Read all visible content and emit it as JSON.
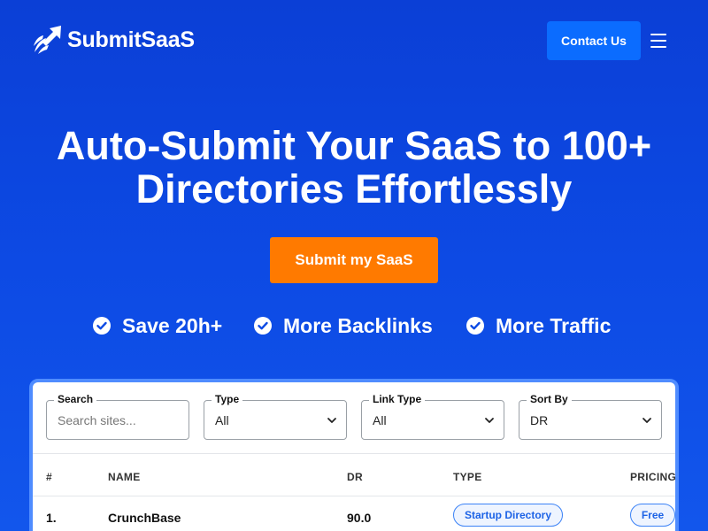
{
  "header": {
    "brand": "SubmitSaaS",
    "contact_label": "Contact Us",
    "logo_icon": "rocket-arrow-icon",
    "menu_icon": "hamburger-menu-icon"
  },
  "hero": {
    "title_line1": "Auto-Submit Your SaaS to 100+",
    "title_line2": "Directories Effortlessly",
    "cta_label": "Submit my SaaS",
    "benefits": [
      "Save 20h+",
      "More Backlinks",
      "More Traffic"
    ]
  },
  "filters": {
    "search": {
      "label": "Search",
      "placeholder": "Search sites..."
    },
    "type": {
      "label": "Type",
      "value": "All"
    },
    "link_type": {
      "label": "Link Type",
      "value": "All"
    },
    "sort_by": {
      "label": "Sort By",
      "value": "DR"
    }
  },
  "table": {
    "headers": [
      "#",
      "NAME",
      "DR",
      "TYPE",
      "PRICING"
    ],
    "rows": [
      {
        "num": "1.",
        "name": "CrunchBase",
        "dr": "90.0",
        "type": "Startup Directory",
        "pricing": "Free"
      }
    ]
  },
  "colors": {
    "background": "#0d4ae4",
    "contact_button": "#0b6cff",
    "cta_button": "#ff7a00",
    "pill_border": "#3b82f6",
    "pill_text": "#1d63e6"
  }
}
